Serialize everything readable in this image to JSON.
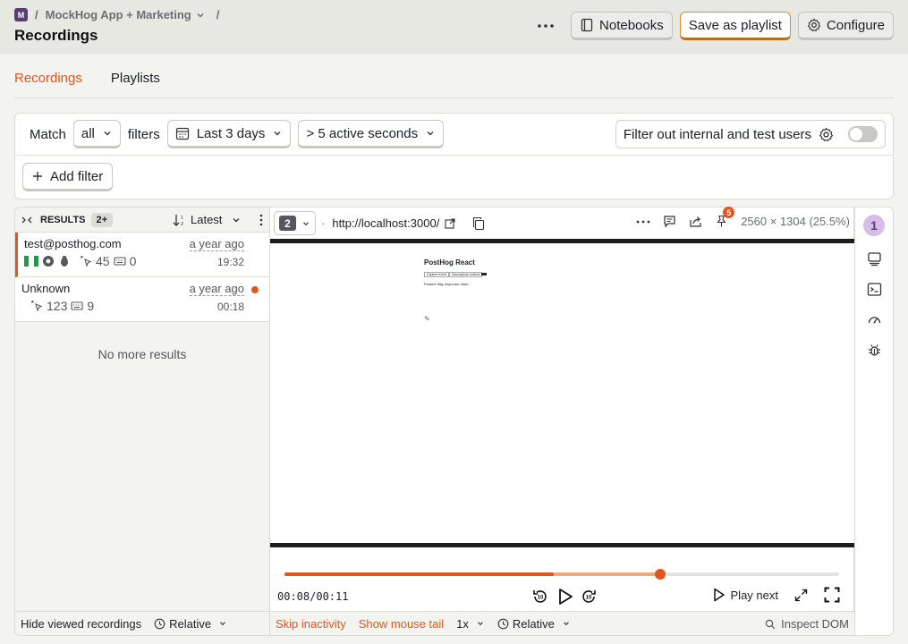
{
  "breadcrumb": {
    "project_initial": "M",
    "project": "MockHog App + Marketing",
    "sep1": "/",
    "sep2": "/"
  },
  "page_title": "Recordings",
  "header_actions": {
    "notebooks": "Notebooks",
    "save_playlist": "Save as playlist",
    "configure": "Configure"
  },
  "tabs": [
    {
      "label": "Recordings",
      "active": true
    },
    {
      "label": "Playlists",
      "active": false
    }
  ],
  "filters": {
    "match_label": "Match",
    "match_value": "all",
    "filters_label": "filters",
    "date_range": "Last 3 days",
    "duration": "> 5 active seconds",
    "internal_toggle_label": "Filter out internal and test users",
    "add_filter": "Add filter"
  },
  "list": {
    "results_label": "RESULTS",
    "results_count": "2+",
    "sort": "Latest",
    "recordings": [
      {
        "name": "test@posthog.com",
        "ago": "a year ago",
        "clicks": "45",
        "keypresses": "0",
        "duration": "19:32",
        "selected": true,
        "unwatched": false
      },
      {
        "name": "Unknown",
        "ago": "a year ago",
        "clicks": "123",
        "keypresses": "9",
        "duration": "00:18",
        "selected": false,
        "unwatched": true
      }
    ],
    "no_more": "No more results",
    "footer_hide_viewed": "Hide viewed recordings",
    "footer_time_mode": "Relative"
  },
  "player": {
    "window_number": "2",
    "url": "http://localhost:3000/",
    "notification_count": "5",
    "resolution": "2560 × 1304 (25.5%)",
    "page_content": {
      "heading": "PostHog React",
      "btn1": "Capture event",
      "btn2": "Autocapture buttons",
      "btn3": "",
      "text": "Feature flag response: false"
    },
    "progress": {
      "played_fraction": 0.485,
      "buffered_fraction": 0.68,
      "handle_fraction": 0.678
    },
    "current_time": "00:08",
    "time_separator": "/",
    "total_time": "00:11",
    "play_next": "Play next",
    "skip_inactivity": "Skip inactivity",
    "show_mouse_tail": "Show mouse tail",
    "speed": "1x",
    "time_mode": "Relative",
    "inspect_dom": "Inspect DOM"
  },
  "sidebar": {
    "person_badge": "1"
  },
  "colors": {
    "accent": "#e0561e",
    "save_border": "#e08a20"
  }
}
